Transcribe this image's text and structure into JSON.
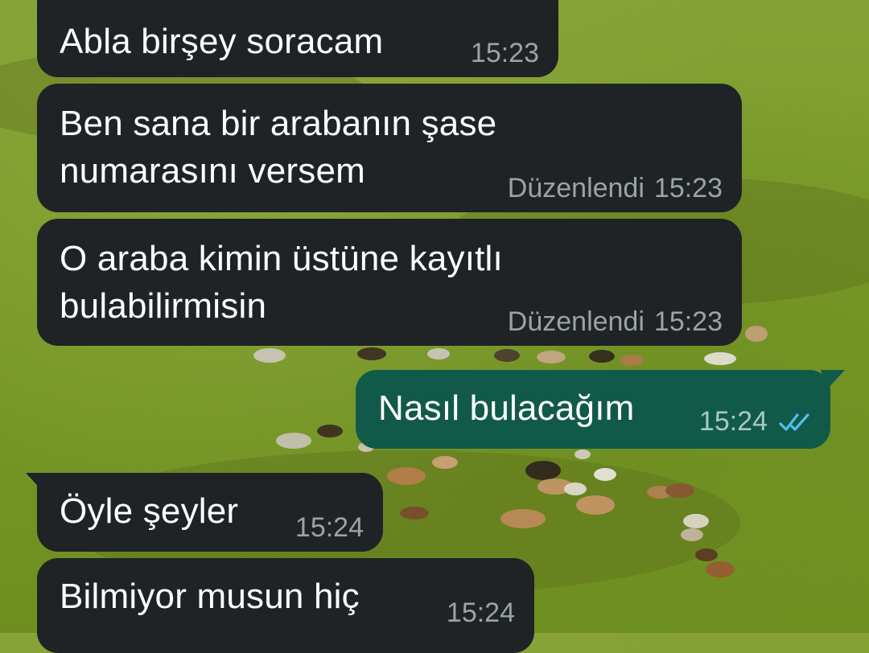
{
  "colors": {
    "incoming_bubble": "#1f2326",
    "outgoing_bubble": "#115a4a",
    "timestamp": "#9aa3a8",
    "read_ticks": "#53bdeb"
  },
  "messages": [
    {
      "text": "Abla birşey soracam",
      "edited_label": "",
      "time": "15:23"
    },
    {
      "text": "Ben sana bir arabanın şase\nnumarasını versem",
      "edited_label": "Düzenlendi",
      "time": "15:23"
    },
    {
      "text": "O araba kimin üstüne kayıtlı\nbulabilirmisin",
      "edited_label": "Düzenlendi",
      "time": "15:23"
    },
    {
      "text": "Nasıl bulacağım",
      "edited_label": "",
      "time": "15:24",
      "status_icon": "double-check-read-icon"
    },
    {
      "text": "Öyle şeyler",
      "edited_label": "",
      "time": "15:24"
    },
    {
      "text": "Bilmiyor musun hiç",
      "edited_label": "",
      "time": "15:24"
    }
  ]
}
